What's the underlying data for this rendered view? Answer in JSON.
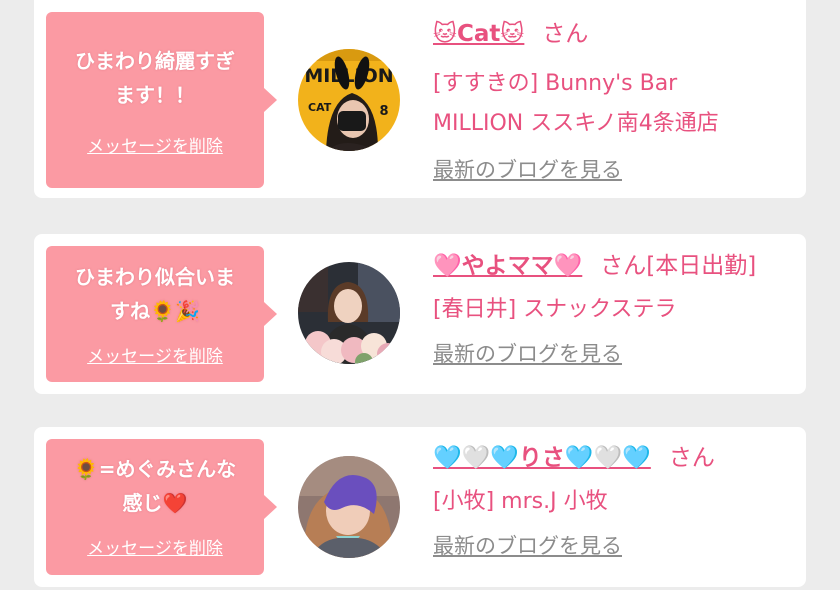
{
  "cards": [
    {
      "message": "ひまわり綺麗すぎ\nます！！",
      "delete_link": "メッセージを削除",
      "name": "🐱Cat🐱",
      "san": "さん",
      "shop": "[すすきの] Bunny's Bar\nMILLION ススキノ南4条通店",
      "blog_link": "最新のブログを見る",
      "avatar_magazine": "MILLION",
      "avatar_issue": "8",
      "avatar_name_label": "CAT"
    },
    {
      "message": "ひまわり似合いま\nすね🌻🎉",
      "delete_link": "メッセージを削除",
      "name": "🩷やよママ🩷",
      "san": "さん[本日出勤]",
      "shop": "[春日井] スナックステラ",
      "blog_link": "最新のブログを見る"
    },
    {
      "message": "🌻=めぐみさんな\n感じ❤️",
      "delete_link": "メッセージを削除",
      "name": "🩵🤍🩵りさ🩵🤍🩵",
      "san": "さん",
      "shop": "[小牧] mrs.J 小牧",
      "blog_link": "最新のブログを見る"
    }
  ],
  "colors": {
    "page_background": "#ececec",
    "card_background": "#ffffff",
    "bubble_pink": "#fb9aa3",
    "accent_pink": "#e8517f",
    "muted_gray": "#8c8c8c"
  }
}
